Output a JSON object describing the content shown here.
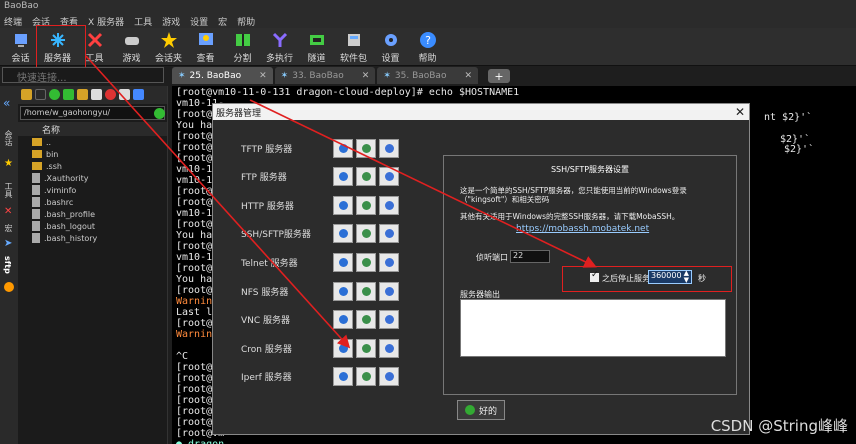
{
  "app": {
    "title": "BaoBao"
  },
  "menu": [
    "终端",
    "会话",
    "查看",
    "X 服务器",
    "工具",
    "游戏",
    "设置",
    "宏",
    "帮助"
  ],
  "toolbar": [
    {
      "label": "会话",
      "icon": "session-icon",
      "color": "#6aa0ff"
    },
    {
      "label": "服务器",
      "icon": "servers-icon",
      "color": "#38b6ff"
    },
    {
      "label": "工具",
      "icon": "tools-icon",
      "color": "#ff4040"
    },
    {
      "label": "游戏",
      "icon": "games-icon",
      "color": "#cccccc"
    },
    {
      "label": "会话夹",
      "icon": "star-icon",
      "color": "#ffcc00"
    },
    {
      "label": "查看",
      "icon": "view-icon",
      "color": "#6aa0ff"
    },
    {
      "label": "分割",
      "icon": "split-icon",
      "color": "#44cc44"
    },
    {
      "label": "多执行",
      "icon": "multiexec-icon",
      "color": "#8a6cff"
    },
    {
      "label": "隧道",
      "icon": "tunnel-icon",
      "color": "#44cc44"
    },
    {
      "label": "软件包",
      "icon": "packages-icon",
      "color": "#cccccc"
    },
    {
      "label": "设置",
      "icon": "settings-icon",
      "color": "#6aa0ff"
    },
    {
      "label": "帮助",
      "icon": "help-icon",
      "color": "#3a8cff"
    }
  ],
  "quickconnect": {
    "placeholder": "快速连接..."
  },
  "tabs": [
    {
      "label": "25. BaoBao",
      "active": true
    },
    {
      "label": "33. BaoBao",
      "active": false
    },
    {
      "label": "35. BaoBao",
      "active": false
    }
  ],
  "sidebar": {
    "vertical_tabs": [
      "会话",
      "工具",
      "宏"
    ],
    "sftp_label": "sftp"
  },
  "filepanel": {
    "path": "/home/w_gaohongyu/",
    "column": "名称",
    "items": [
      {
        "name": "..",
        "type": "folder"
      },
      {
        "name": "bin",
        "type": "folder"
      },
      {
        "name": ".ssh",
        "type": "folder"
      },
      {
        "name": ".Xauthority",
        "type": "file"
      },
      {
        "name": ".viminfo",
        "type": "file"
      },
      {
        "name": ".bashrc",
        "type": "file"
      },
      {
        "name": ".bash_profile",
        "type": "file"
      },
      {
        "name": ".bash_logout",
        "type": "file"
      },
      {
        "name": ".bash_history",
        "type": "file"
      }
    ]
  },
  "terminal": {
    "lines": [
      "[root@vm10-11-0-131 dragon-cloud-deploy]# echo $HOSTNAME1",
      "vm10-11-",
      "[root@vm",
      "You have",
      "[root@vm",
      "[root@vm",
      "[root@vm",
      "vm10-11-",
      "vm10-11-",
      "[root@vm",
      "[root@vm",
      "vm10-11-",
      "[root@vm",
      "You have",
      "[root@vm",
      "vm10-11-",
      "[root@vm",
      "You have",
      "[root@vm",
      "Warning:",
      "Last log",
      "[root@vm",
      "Warning:",
      "",
      "^C",
      "[root@vm",
      "[root@vm",
      "[root@vm",
      "[root@vm",
      "[root@vm",
      "[root@vm",
      "[root@vm",
      "● dragon"
    ],
    "right_fragments": [
      "nt $2}'`",
      "$2}'`",
      "$2}'`"
    ]
  },
  "dialog": {
    "title": "服务器管理",
    "services": [
      "TFTP 服务器",
      "FTP 服务器",
      "HTTP 服务器",
      "SSH/SFTP服务器",
      "Telnet 服务器",
      "NFS 服务器",
      "VNC 服务器",
      "Cron 服务器",
      "Iperf 服务器"
    ],
    "ssh_panel": {
      "title": "SSH/SFTP服务器设置",
      "desc_line1": "这是一个简单的SSH/SFTP服务器，您只能使用当前的Windows登录",
      "desc_line2": "（\"kingsoft\"）和相关密码",
      "desc_line3": "其他有关适用于Windows的完整SSH服务器，请下载MobaSSH。",
      "link": "https://mobassh.mobatek.net",
      "port_label": "侦听端口",
      "port_value": "22",
      "stop_label": "之后停止服务器",
      "stop_value": "360000",
      "stop_unit": "秒",
      "output_label": "服务器输出"
    },
    "ok_label": "好的"
  },
  "watermark": "CSDN @String峰峰"
}
